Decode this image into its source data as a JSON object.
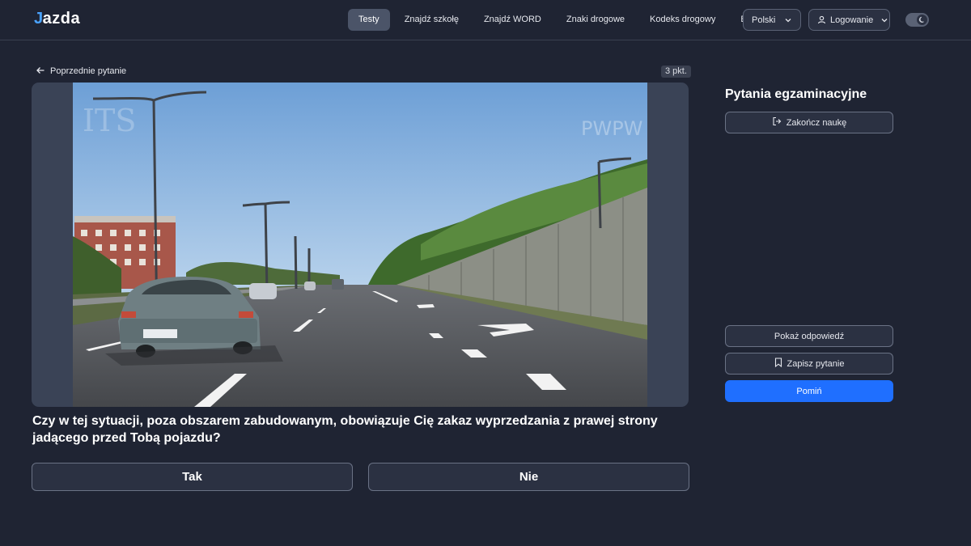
{
  "header": {
    "logo_text": "azda",
    "logo_mark": "J",
    "nav": [
      "Testy",
      "Znajdź szkołę",
      "Znajdź WORD",
      "Znaki drogowe",
      "Kodeks drogowy",
      "Blog"
    ],
    "active_nav": "Testy",
    "language": "Polski",
    "login": "Logowanie"
  },
  "main": {
    "back_label": "Poprzednie pytanie",
    "points": "3 pkt.",
    "watermark_right": "PWPW",
    "watermark_left": "ITS",
    "question": "Czy w tej sytuacji, poza obszarem zabudowanym, obowiązuje Cię zakaz wyprzedzania z prawej strony jadącego przed Tobą pojazdu?",
    "answers": [
      "Tak",
      "Nie"
    ]
  },
  "sidebar": {
    "title": "Pytania egzaminacyjne",
    "end_label": "Zakończ naukę",
    "show_answer": "Pokaż odpowiedź",
    "save_question": "Zapisz pytanie",
    "skip": "Pomiń"
  },
  "colors": {
    "background": "#1f2433",
    "accent": "#1f6fff",
    "logo_accent": "#4aa3ff"
  },
  "icons": {
    "back": "arrow-left-icon",
    "language": "chevron-down-icon",
    "login": "user-icon",
    "theme": "moon-icon",
    "end": "logout-icon",
    "save": "bookmark-icon"
  }
}
